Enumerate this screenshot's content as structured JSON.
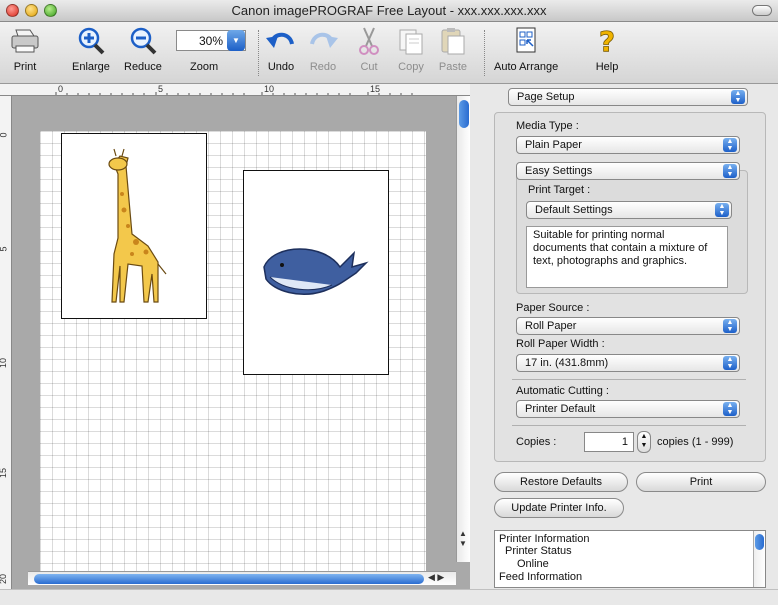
{
  "window": {
    "title": "Canon imagePROGRAF Free Layout - xxx.xxx.xxx.xxx"
  },
  "toolbar": {
    "print": "Print",
    "enlarge": "Enlarge",
    "reduce": "Reduce",
    "zoom": "Zoom",
    "zoom_value": "30%",
    "undo": "Undo",
    "redo": "Redo",
    "cut": "Cut",
    "copy": "Copy",
    "paste": "Paste",
    "auto_arrange": "Auto Arrange",
    "help": "Help"
  },
  "rulers": {
    "horizontal": [
      "0",
      "5",
      "10",
      "15"
    ],
    "vertical": [
      "0",
      "5",
      "10",
      "15",
      "20"
    ]
  },
  "panel": {
    "section_select": "Page Setup",
    "media_type_label": "Media Type :",
    "media_type": "Plain Paper",
    "settings_mode": "Easy Settings",
    "print_target_label": "Print Target :",
    "print_target": "Default Settings",
    "description": "Suitable for printing normal documents that contain a mixture of text, photographs and graphics.",
    "paper_source_label": "Paper Source :",
    "paper_source": "Roll Paper",
    "roll_width_label": "Roll Paper Width :",
    "roll_width": "17 in. (431.8mm)",
    "auto_cut_label": "Automatic Cutting :",
    "auto_cut": "Printer Default",
    "copies_label": "Copies :",
    "copies_value": "1",
    "copies_range": "copies (1 - 999)",
    "restore_defaults": "Restore Defaults",
    "print_button": "Print",
    "update_printer": "Update Printer Info.",
    "info_lines": [
      "Printer Information",
      "Printer Status",
      "Online",
      "Feed Information"
    ]
  },
  "colors": {
    "accent": "#2a6cd0",
    "canvas_bg": "#a9a9a9"
  },
  "icons": [
    "printer-icon",
    "zoom-in-icon",
    "zoom-out-icon",
    "undo-icon",
    "redo-icon",
    "scissors-icon",
    "copy-icon",
    "paste-icon",
    "auto-arrange-icon",
    "help-icon",
    "giraffe-image",
    "whale-image"
  ]
}
